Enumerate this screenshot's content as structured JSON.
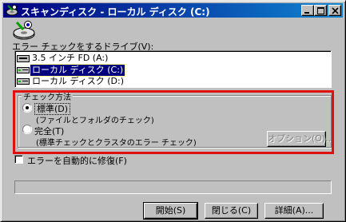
{
  "window": {
    "title": "スキャンディスク - ローカル ディスク (C:)"
  },
  "drives": {
    "label": "エラー チェックをするドライブ(V):",
    "items": [
      {
        "label": "3.5 インチ FD (A:)",
        "icon": "floppy-drive-icon",
        "selected": false
      },
      {
        "label": "ローカル ディスク (C:)",
        "icon": "hard-disk-icon",
        "selected": true
      },
      {
        "label": "ローカル ディスク (D:)",
        "icon": "hard-disk-icon",
        "selected": false
      }
    ]
  },
  "check_method": {
    "title": "チェック方法",
    "standard": {
      "label": "標準(D)",
      "desc": "(ファイルとフォルダのチェック)",
      "checked": true
    },
    "thorough": {
      "label": "完全(T)",
      "desc": "(標準チェックとクラスタのエラー チェック)",
      "checked": false
    },
    "options_button": "オプション(O)..."
  },
  "auto_fix": {
    "label": "エラーを自動的に修復(F)",
    "checked": false
  },
  "progress": {
    "value": 0
  },
  "buttons": {
    "start": "開始(S)",
    "close": "閉じる(C)",
    "details": "詳細(A)..."
  },
  "colors": {
    "title_bar": "#000080",
    "highlight_frame": "#e01010",
    "selection": "#000080"
  }
}
